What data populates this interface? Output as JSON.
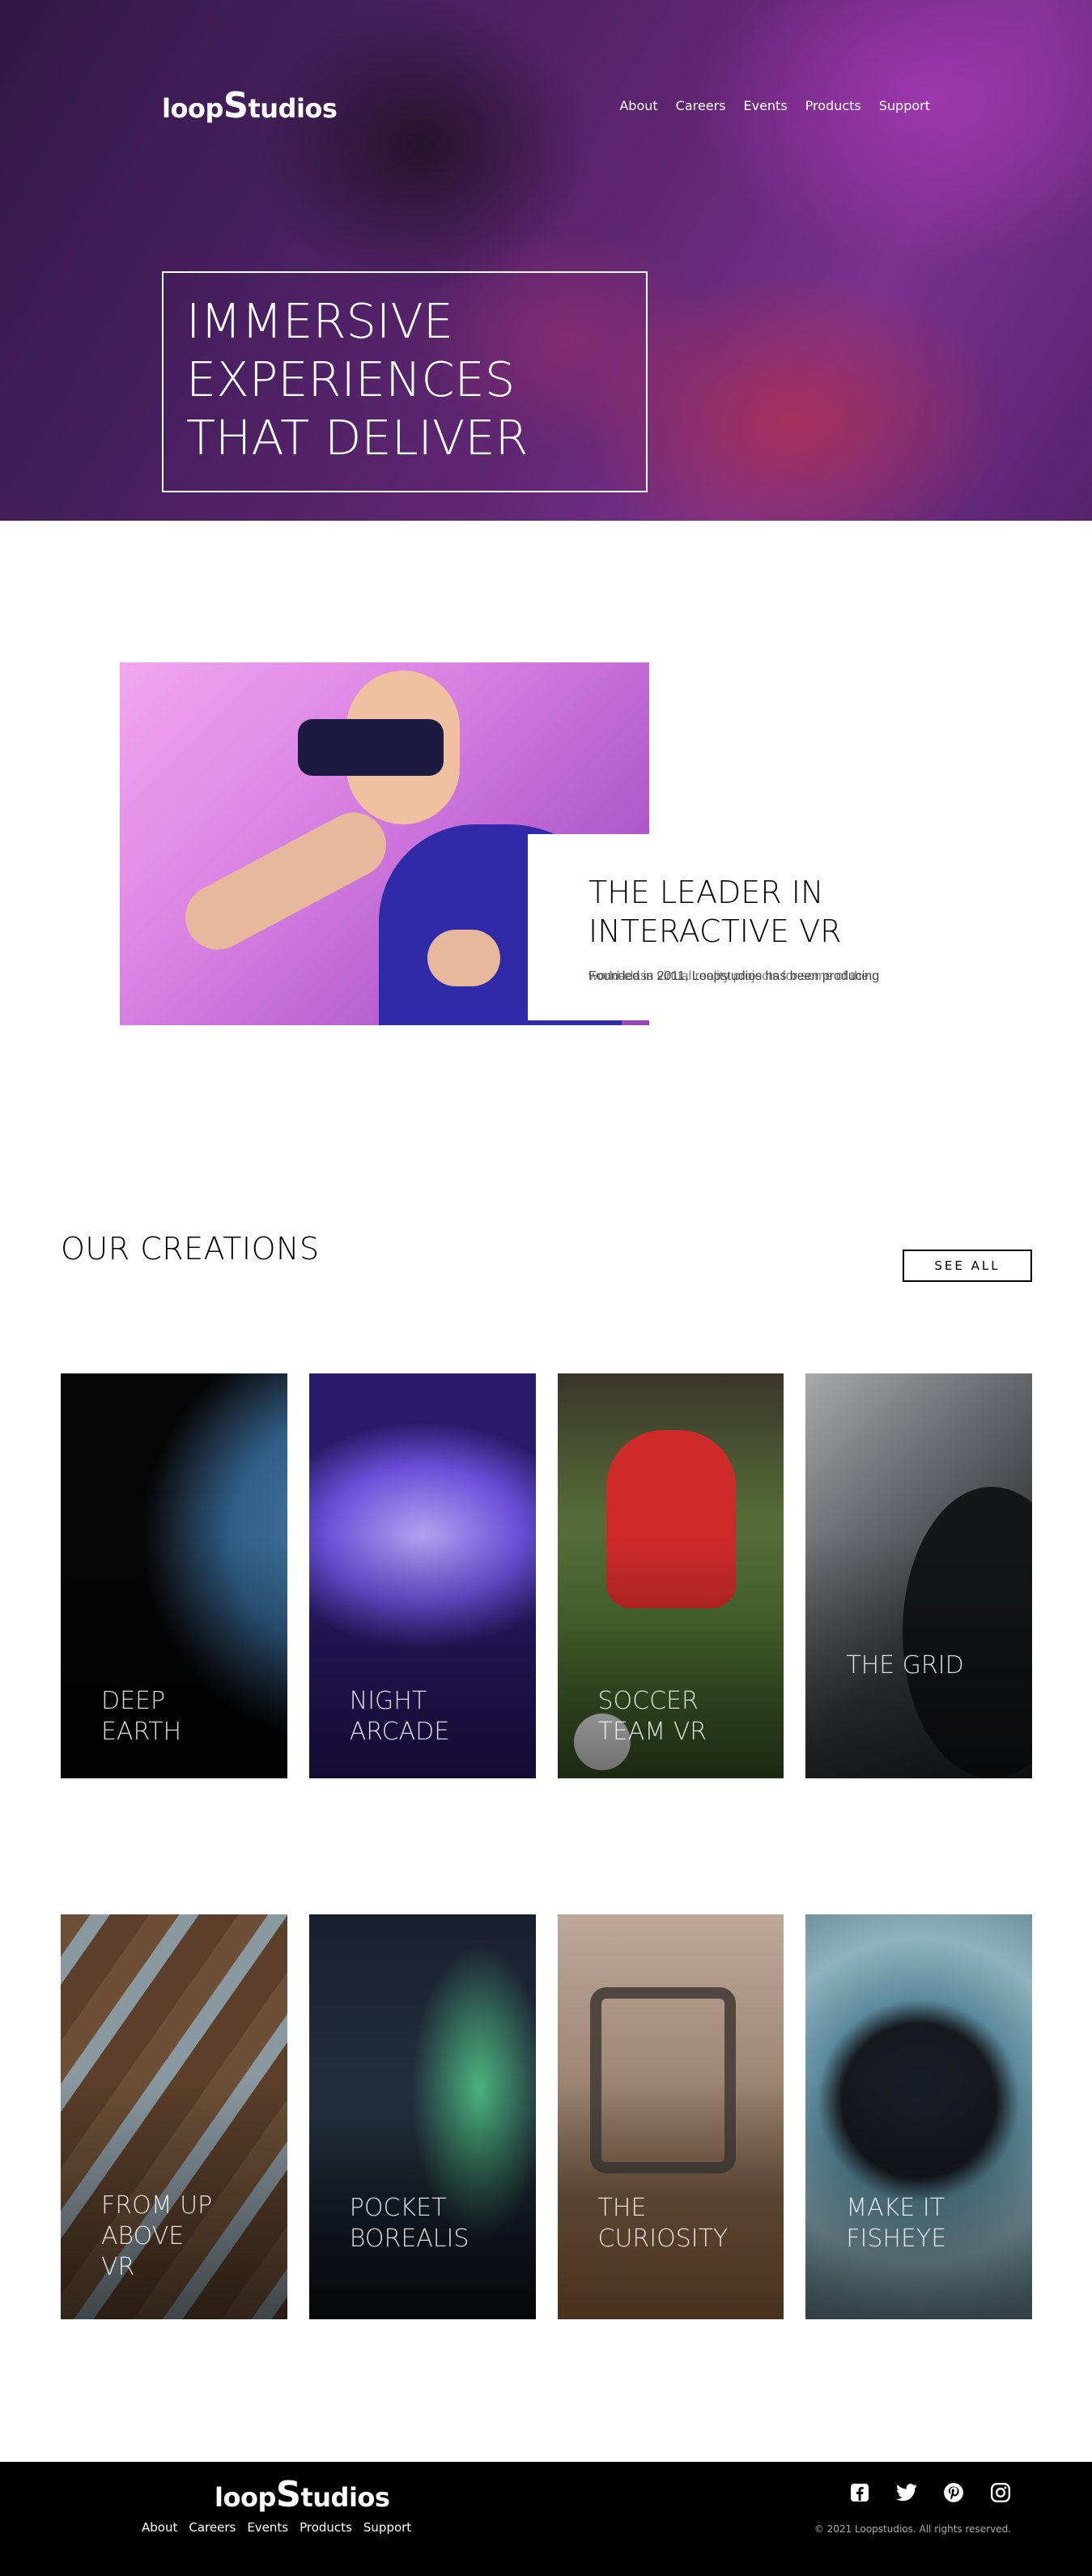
{
  "header": {
    "logo_prefix": "loop",
    "logo_big": "S",
    "logo_suffix": "tudios",
    "nav": [
      "About",
      "Careers",
      "Events",
      "Products",
      "Support"
    ]
  },
  "hero": {
    "title": "IMMERSIVE\nEXPERIENCES\nTHAT DELIVER"
  },
  "interactive": {
    "title": "THE LEADER IN\nINTERACTIVE VR",
    "body_line1": "Founded in 2011, Loopstudios has been producing",
    "body_line2": "world-class virtual reality projects for some of the"
  },
  "creations": {
    "title": "OUR CREATIONS",
    "see_all": "SEE ALL",
    "items": [
      {
        "label": "DEEP\nEARTH"
      },
      {
        "label": "NIGHT\nARCADE"
      },
      {
        "label": "SOCCER\nTEAM VR"
      },
      {
        "label": "THE GRID"
      },
      {
        "label": "FROM UP\nABOVE\nVR"
      },
      {
        "label": "POCKET\nBOREALIS"
      },
      {
        "label": "THE\nCURIOSITY"
      },
      {
        "label": "MAKE IT\nFISHEYE"
      }
    ]
  },
  "footer": {
    "logo_prefix": "loop",
    "logo_big": "S",
    "logo_suffix": "tudios",
    "nav": [
      "About",
      "Careers",
      "Events",
      "Products",
      "Support"
    ],
    "socials": [
      "facebook-icon",
      "twitter-icon",
      "pinterest-icon",
      "instagram-icon"
    ],
    "copyright": "© 2021 Loopstudios. All rights reserved."
  }
}
